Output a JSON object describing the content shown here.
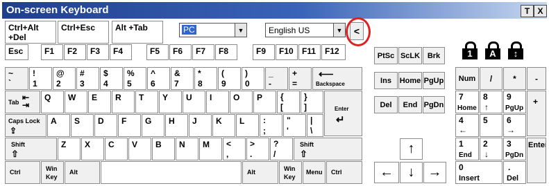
{
  "window": {
    "title": "On-screen Keyboard",
    "buttons": [
      "T",
      "X"
    ]
  },
  "top": {
    "ctrl_alt_del": "Ctrl+Alt\n+Del",
    "ctrl_esc": "Ctrl+Esc",
    "alt_tab": "Alt +Tab",
    "target": "PC",
    "language": "English US",
    "collapse": "<"
  },
  "keys": {
    "esc": "Esc",
    "f1": "F1",
    "f2": "F2",
    "f3": "F3",
    "f4": "F4",
    "f5": "F5",
    "f6": "F6",
    "f7": "F7",
    "f8": "F8",
    "f9": "F9",
    "f10": "F10",
    "f11": "F11",
    "f12": "F12",
    "prtsc": "PtSc",
    "sclk": "ScLK",
    "brk": "Brk",
    "tilde_top": "~",
    "tilde_bot": "`",
    "n1_top": "!",
    "n1_bot": "1",
    "n2_top": "@",
    "n2_bot": "2",
    "n3_top": "#",
    "n3_bot": "3",
    "n4_top": "$",
    "n4_bot": "4",
    "n5_top": "%",
    "n5_bot": "5",
    "n6_top": "^",
    "n6_bot": "6",
    "n7_top": "&",
    "n7_bot": "7",
    "n8_top": "*",
    "n8_bot": "8",
    "n9_top": "(",
    "n9_bot": "9",
    "n0_top": ")",
    "n0_bot": "0",
    "minus_top": "_",
    "minus_bot": "-",
    "eq_top": "+",
    "eq_bot": "=",
    "backspace": "Backspace",
    "ins": "Ins",
    "home": "Home",
    "pgup": "PgUp",
    "num": "Num",
    "np_div": "/",
    "np_mul": "*",
    "np_sub": "-",
    "tab": "Tab",
    "q": "Q",
    "w": "W",
    "e": "E",
    "r": "R",
    "t": "T",
    "y": "Y",
    "u": "U",
    "i": "I",
    "o": "O",
    "p": "P",
    "lbr_top": "{",
    "lbr_bot": "[",
    "rbr_top": "}",
    "rbr_bot": "]",
    "enter": "Enter",
    "del": "Del",
    "end": "End",
    "pgdn": "PgDn",
    "np7": "7",
    "np7_sub": "Home",
    "np8": "8",
    "np9": "9",
    "np9_sub": "PgUp",
    "np_add": "+",
    "caps": "Caps Lock",
    "a": "A",
    "s": "S",
    "d": "D",
    "f": "F",
    "g": "G",
    "h": "H",
    "j": "J",
    "k": "K",
    "l": "L",
    "semi_top": ":",
    "semi_bot": ";",
    "quote_top": "\"",
    "quote_bot": "'",
    "bslash_top": "|",
    "bslash_bot": "\\",
    "np4": "4",
    "np5": "5",
    "np6": "6",
    "shift": "Shift",
    "z": "Z",
    "x": "X",
    "c": "C",
    "v": "V",
    "b": "B",
    "n": "N",
    "m": "M",
    "comma_top": "<",
    "comma_bot": ",",
    "period_top": ">",
    "period_bot": ".",
    "slash_top": "?",
    "slash_bot": "/",
    "np1": "1",
    "np1_sub": "End",
    "np2": "2",
    "np3": "3",
    "np3_sub": "PgDn",
    "np_enter": "Enter",
    "ctrl": "Ctrl",
    "win": "Win\nKey",
    "alt": "Alt",
    "menu": "Menu",
    "np0": "0",
    "np0_sub": "Insert",
    "np_dot": ".",
    "np_dot_sub": "Del",
    "arrow_up": "↑",
    "arrow_down": "↓",
    "arrow_left": "←",
    "arrow_right": "→"
  },
  "locks": [
    "1",
    "A",
    "↕"
  ],
  "colors": {
    "title_bar": "#1f3f8c",
    "highlight_circle": "#e02020",
    "selected_target": "#3366cc"
  }
}
